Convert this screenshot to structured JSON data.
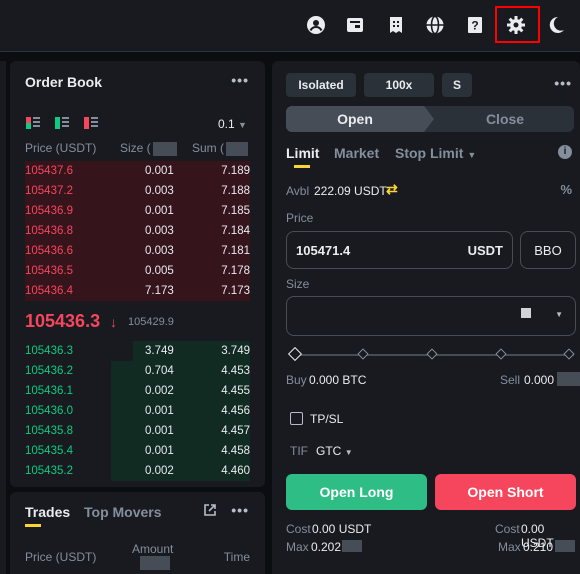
{
  "topbar": {
    "icons": [
      "account-icon",
      "wallet-icon",
      "orders-icon",
      "language-icon",
      "download-icon",
      "settings-icon",
      "theme-icon"
    ]
  },
  "order_book": {
    "title": "Order Book",
    "menu": "•••",
    "precision": "0.1",
    "col_price": "Price (USDT)",
    "col_size": "Size (",
    "col_sum": "Sum (",
    "asks": [
      {
        "price": "105437.6",
        "size": "0.001",
        "sum": "7.189",
        "depth": 1.0
      },
      {
        "price": "105437.2",
        "size": "0.003",
        "sum": "7.188",
        "depth": 1.0
      },
      {
        "price": "105436.9",
        "size": "0.001",
        "sum": "7.185",
        "depth": 1.0
      },
      {
        "price": "105436.8",
        "size": "0.003",
        "sum": "7.184",
        "depth": 1.0
      },
      {
        "price": "105436.6",
        "size": "0.003",
        "sum": "7.181",
        "depth": 1.0
      },
      {
        "price": "105436.5",
        "size": "0.005",
        "sum": "7.178",
        "depth": 1.0
      },
      {
        "price": "105436.4",
        "size": "7.173",
        "sum": "7.173",
        "depth": 1.0
      }
    ],
    "mid_price": "105436.3",
    "mid_arrow": "↓",
    "mark_price": "105429.9",
    "bids": [
      {
        "price": "105436.3",
        "size": "3.749",
        "sum": "3.749",
        "depth": 0.52
      },
      {
        "price": "105436.2",
        "size": "0.704",
        "sum": "4.453",
        "depth": 0.62
      },
      {
        "price": "105436.1",
        "size": "0.002",
        "sum": "4.455",
        "depth": 0.62
      },
      {
        "price": "105436.0",
        "size": "0.001",
        "sum": "4.456",
        "depth": 0.62
      },
      {
        "price": "105435.8",
        "size": "0.001",
        "sum": "4.457",
        "depth": 0.62
      },
      {
        "price": "105435.4",
        "size": "0.001",
        "sum": "4.458",
        "depth": 0.62
      },
      {
        "price": "105435.2",
        "size": "0.002",
        "sum": "4.460",
        "depth": 0.62
      }
    ]
  },
  "trades": {
    "tab_trades": "Trades",
    "tab_movers": "Top Movers",
    "menu": "•••",
    "col_price": "Price (USDT)",
    "col_amount": "Amount",
    "col_time": "Time"
  },
  "trade_panel": {
    "margin_mode": "Isolated",
    "leverage": "100x",
    "asset_mode": "S",
    "menu": "•••",
    "open": "Open",
    "close": "Close",
    "tab_limit": "Limit",
    "tab_market": "Market",
    "tab_stop": "Stop Limit",
    "avbl_label": "Avbl",
    "avbl_value": "222.09 USDT",
    "price_label": "Price",
    "price_value": "105471.4",
    "price_unit": "USDT",
    "bbo": "BBO",
    "size_label": "Size",
    "buy_label": "Buy",
    "buy_value": "0.000 BTC",
    "sell_label": "Sell",
    "sell_value": "0.000",
    "tpsl": "TP/SL",
    "tif_label": "TIF",
    "tif_value": "GTC",
    "open_long": "Open Long",
    "open_short": "Open Short",
    "cost_label_l": "Cost",
    "cost_value_l": "0.00 USDT",
    "cost_label_r": "Cost",
    "cost_value_r": "0.00 USDT",
    "max_label_l": "Max",
    "max_value_l": "0.202",
    "max_label_r": "Max",
    "max_value_r": "0.210"
  },
  "colors": {
    "accent": "#fcd535",
    "ask": "#f6465d",
    "bid": "#0ecb81",
    "highlight": "#ff0000"
  }
}
